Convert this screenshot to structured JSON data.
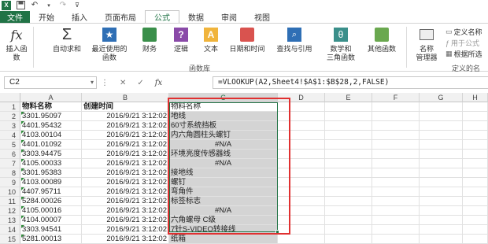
{
  "ribbon_tabs": [
    "文件",
    "开始",
    "插入",
    "页面布局",
    "公式",
    "数据",
    "审阅",
    "视图"
  ],
  "active_tab": "公式",
  "ribbon": {
    "insert_function": "插入函数",
    "autosum": "自动求和",
    "recent": "最近使用的\n函数",
    "financial": "财务",
    "logical": "逻辑",
    "text": "文本",
    "datetime": "日期和时间",
    "lookup": "查找与引用",
    "math": "数学和\n三角函数",
    "other": "其他函数",
    "name_manager": "名称\n管理器",
    "define_name": "定义名称",
    "use_in_formula": "用于公式",
    "create_from_selection": "根据所选",
    "group_library": "函数库",
    "group_defined": "定义的名"
  },
  "formula_bar": {
    "name_box": "C2",
    "fx": "fx",
    "formula": "=VLOOKUP(A2,Sheet4!$A$1:$B$28,2,FALSE)"
  },
  "columns": [
    "A",
    "B",
    "C",
    "D",
    "E",
    "F",
    "G",
    "H"
  ],
  "header_row": {
    "a": "物料名称",
    "b": "创建时间",
    "c": "物料名称"
  },
  "rows": [
    {
      "num": "2",
      "a": "3301.95097",
      "b": "2016/9/21  3:12:02",
      "c": "地线"
    },
    {
      "num": "3",
      "a": "4401.95432",
      "b": "2016/9/21  3:12:02",
      "c": "60寸系统挡板"
    },
    {
      "num": "4",
      "a": "4103.00104",
      "b": "2016/9/21  3:12:02",
      "c": "内六角圆柱头螺钉"
    },
    {
      "num": "5",
      "a": "4401.01092",
      "b": "2016/9/21  3:12:02",
      "c": "#N/A"
    },
    {
      "num": "6",
      "a": "3303.94475",
      "b": "2016/9/21  3:12:02",
      "c": "环境亮度传感器线"
    },
    {
      "num": "7",
      "a": "4105.00033",
      "b": "2016/9/21  3:12:02",
      "c": "#N/A"
    },
    {
      "num": "8",
      "a": "3301.95383",
      "b": "2016/9/21  3:12:02",
      "c": "接地线"
    },
    {
      "num": "9",
      "a": "4103.00089",
      "b": "2016/9/21  3:12:02",
      "c": "螺钉"
    },
    {
      "num": "10",
      "a": "4407.95711",
      "b": "2016/9/21  3:12:02",
      "c": "弯角件"
    },
    {
      "num": "11",
      "a": "5284.00026",
      "b": "2016/9/21  3:12:02",
      "c": "标签标志"
    },
    {
      "num": "12",
      "a": "4105.00016",
      "b": "2016/9/21  3:12:02",
      "c": "#N/A"
    },
    {
      "num": "13",
      "a": "4104.00007",
      "b": "2016/9/21  3:12:02",
      "c": "六角螺母 C级"
    },
    {
      "num": "14",
      "a": "3303.94541",
      "b": "2016/9/21  3:12:02",
      "c": "7针S-VIDEO转接线"
    },
    {
      "num": "15",
      "a": "5281.00013",
      "b": "2016/9/21  3:12:02",
      "c": "纸箱"
    }
  ],
  "colors": {
    "accent": "#217346",
    "highlight": "#e03030",
    "selection_fill": "#d4d4d4"
  }
}
